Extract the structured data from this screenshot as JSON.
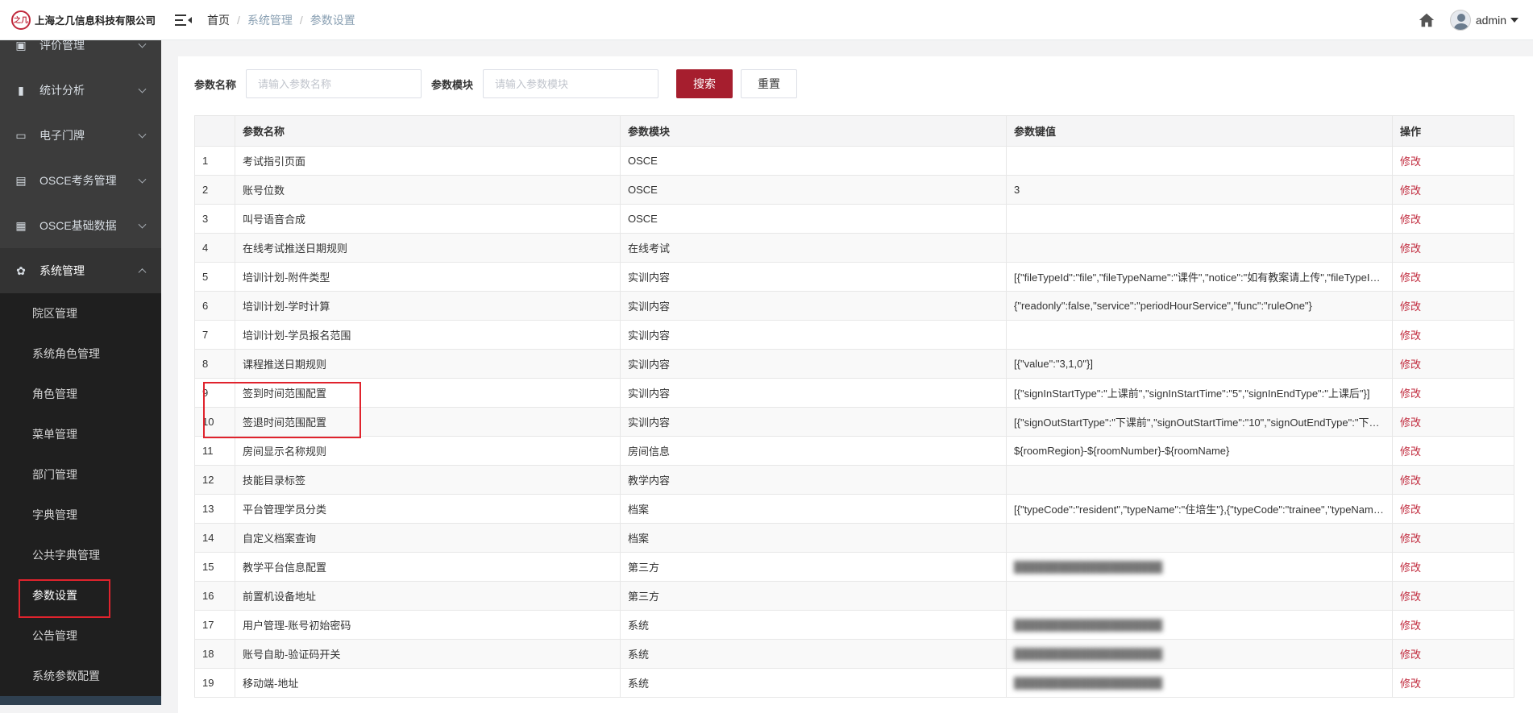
{
  "brand": {
    "logo_text": "之几",
    "name": "上海之几信息科技有限公司"
  },
  "topbar": {
    "breadcrumb": [
      "首页",
      "系统管理",
      "参数设置"
    ],
    "user": "admin"
  },
  "sidebar": {
    "items": [
      {
        "label": "评价管理",
        "icon": "star-icon",
        "open": false
      },
      {
        "label": "统计分析",
        "icon": "bar-chart-icon",
        "open": false
      },
      {
        "label": "电子门牌",
        "icon": "monitor-icon",
        "open": false
      },
      {
        "label": "OSCE考务管理",
        "icon": "clipboard-icon",
        "open": false
      },
      {
        "label": "OSCE基础数据",
        "icon": "database-icon",
        "open": false
      },
      {
        "label": "系统管理",
        "icon": "gear-icon",
        "open": true
      }
    ],
    "subitems": [
      "院区管理",
      "系统角色管理",
      "角色管理",
      "菜单管理",
      "部门管理",
      "字典管理",
      "公共字典管理",
      "参数设置",
      "公告管理",
      "系统参数配置"
    ],
    "active_subitem": "参数设置"
  },
  "search": {
    "name_label": "参数名称",
    "name_placeholder": "请输入参数名称",
    "module_label": "参数模块",
    "module_placeholder": "请输入参数模块",
    "search_button": "搜索",
    "reset_button": "重置"
  },
  "table": {
    "columns": [
      "",
      "参数名称",
      "参数模块",
      "参数键值",
      "操作"
    ],
    "rows": [
      {
        "no": "1",
        "name": "考试指引页面",
        "module": "OSCE",
        "value": "",
        "op": "修改"
      },
      {
        "no": "2",
        "name": "账号位数",
        "module": "OSCE",
        "value": "3",
        "op": "修改"
      },
      {
        "no": "3",
        "name": "叫号语音合成",
        "module": "OSCE",
        "value": "",
        "op": "修改"
      },
      {
        "no": "4",
        "name": "在线考试推送日期规则",
        "module": "在线考试",
        "value": "",
        "op": "修改"
      },
      {
        "no": "5",
        "name": "培训计划-附件类型",
        "module": "实训内容",
        "value": "[{\"fileTypeId\":\"file\",\"fileTypeName\":\"课件\",\"notice\":\"如有教案请上传\",\"fileTypeIds\":\"\"}]",
        "op": "修改"
      },
      {
        "no": "6",
        "name": "培训计划-学时计算",
        "module": "实训内容",
        "value": "{\"readonly\":false,\"service\":\"periodHourService\",\"func\":\"ruleOne\"}",
        "op": "修改"
      },
      {
        "no": "7",
        "name": "培训计划-学员报名范围",
        "module": "实训内容",
        "value": "",
        "op": "修改"
      },
      {
        "no": "8",
        "name": "课程推送日期规则",
        "module": "实训内容",
        "value": "[{\"value\":\"3,1,0\"}]",
        "op": "修改"
      },
      {
        "no": "9",
        "name": "签到时间范围配置",
        "module": "实训内容",
        "value": "[{\"signInStartType\":\"上课前\",\"signInStartTime\":\"5\",\"signInEndType\":\"上课后\"}]",
        "op": "修改"
      },
      {
        "no": "10",
        "name": "签退时间范围配置",
        "module": "实训内容",
        "value": "[{\"signOutStartType\":\"下课前\",\"signOutStartTime\":\"10\",\"signOutEndType\":\"下课后\"}]",
        "op": "修改"
      },
      {
        "no": "11",
        "name": "房间显示名称规则",
        "module": "房间信息",
        "value": "${roomRegion}-${roomNumber}-${roomName}",
        "op": "修改"
      },
      {
        "no": "12",
        "name": "技能目录标签",
        "module": "教学内容",
        "value": "",
        "op": "修改"
      },
      {
        "no": "13",
        "name": "平台管理学员分类",
        "module": "档案",
        "value": "[{\"typeCode\":\"resident\",\"typeName\":\"住培生\"},{\"typeCode\":\"trainee\",\"typeName\":\"\"}]",
        "op": "修改"
      },
      {
        "no": "14",
        "name": "自定义档案查询",
        "module": "档案",
        "value": "",
        "op": "修改"
      },
      {
        "no": "15",
        "name": "教学平台信息配置",
        "module": "第三方",
        "value": "",
        "op": "修改",
        "blurred": true
      },
      {
        "no": "16",
        "name": "前置机设备地址",
        "module": "第三方",
        "value": "",
        "op": "修改"
      },
      {
        "no": "17",
        "name": "用户管理-账号初始密码",
        "module": "系统",
        "value": "",
        "op": "修改",
        "blurred": true
      },
      {
        "no": "18",
        "name": "账号自助-验证码开关",
        "module": "系统",
        "value": "",
        "op": "修改",
        "blurred": true
      },
      {
        "no": "19",
        "name": "移动端-地址",
        "module": "系统",
        "value": "",
        "op": "修改",
        "blurred": true
      }
    ]
  },
  "colors": {
    "accent": "#a61e2e",
    "sidebar_bg": "#3c3c3c",
    "submenu_bg": "#1f1f1f",
    "link": "#c0293c",
    "highlight": "#e0232d"
  }
}
